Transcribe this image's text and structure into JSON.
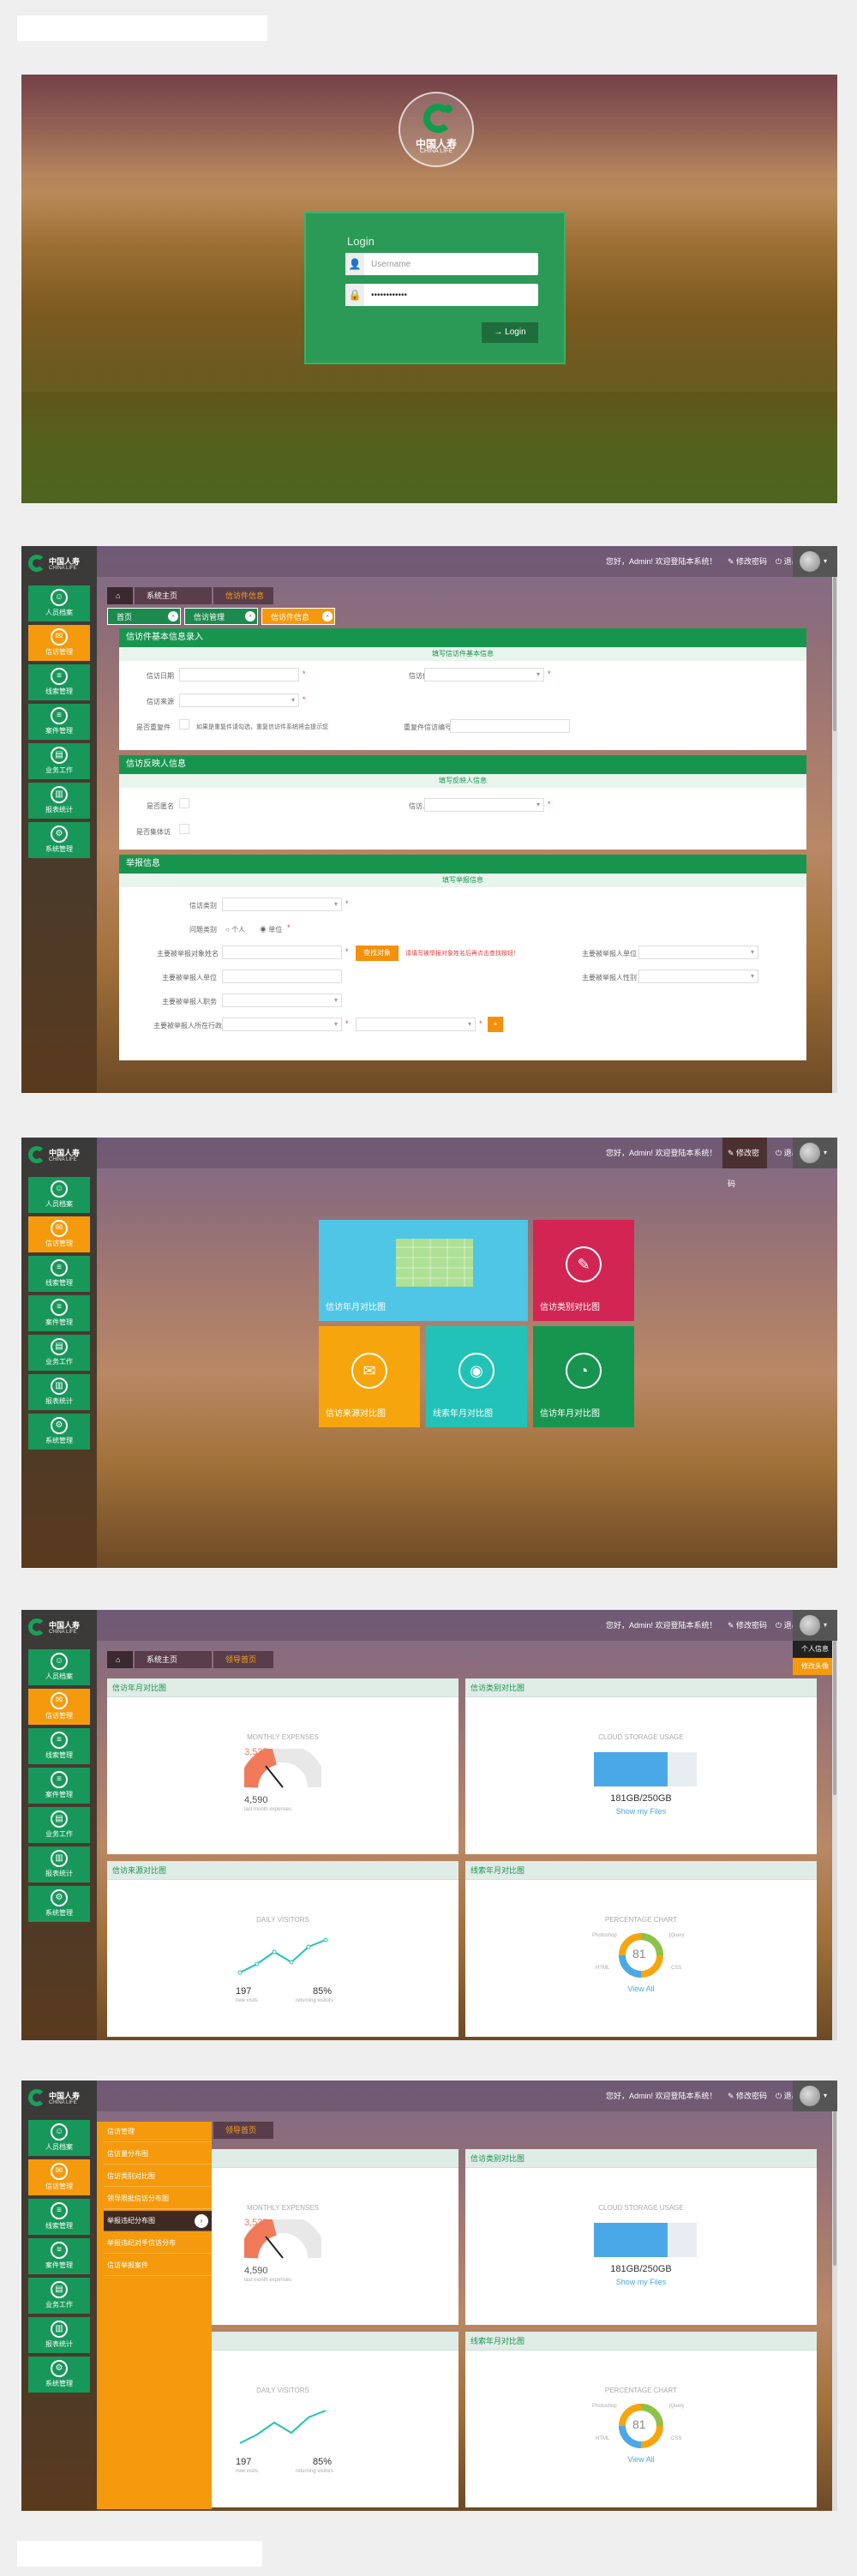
{
  "login": {
    "logo_cn": "中国人寿",
    "logo_en": "CHINA LIFE",
    "title": "Login",
    "username_placeholder": "Username",
    "password_value": "••••••••••••",
    "button": "Login",
    "user_icon": "user-icon",
    "lock_icon": "lock-icon"
  },
  "brand": {
    "cn": "中国人寿",
    "en": "CHINA LIFE"
  },
  "sidebar": {
    "items": [
      {
        "label": "人员档案",
        "icon": "person-icon"
      },
      {
        "label": "信访管理",
        "icon": "mail-icon"
      },
      {
        "label": "线索管理",
        "icon": "list-icon"
      },
      {
        "label": "案件管理",
        "icon": "list-icon"
      },
      {
        "label": "业务工作",
        "icon": "doc-icon"
      },
      {
        "label": "报表统计",
        "icon": "chart-icon"
      },
      {
        "label": "系统管理",
        "icon": "gear-icon"
      }
    ]
  },
  "topbar": {
    "greeting": "您好，Admin! 欢迎登陆本系统！",
    "change_pwd": "修改密码",
    "logout": "退出"
  },
  "screen2": {
    "crumbs": [
      "系统主页",
      "信访件信息"
    ],
    "tabs": [
      "首页",
      "信访管理",
      "信访件信息"
    ],
    "panel1": {
      "title": "信访件基本信息录入",
      "sub": "填写信访件基本信息",
      "f1": "信访日期",
      "f2": "信访件号",
      "f3": "信访来源",
      "f4": "是否重复件",
      "chk": "如果是重复件请勾选，重复信访件系统将会提示您",
      "f5": "重复件信访编号"
    },
    "panel2": {
      "title": "信访反映人信息",
      "sub": "填写反映人信息",
      "f1": "是否匿名",
      "f2": "信访人数",
      "f3": "是否集体访"
    },
    "panel3": {
      "title": "举报信息",
      "sub": "填写举报信息",
      "f1": "信访类别",
      "f2": "问题类别",
      "r1": "个人",
      "r2": "单位",
      "f3": "主要被举报对象姓名",
      "btn": "查找对象",
      "warn": "请填写被举报对象姓名后再点击查找按钮！",
      "f4": "主要被举报人单位",
      "f5": "主要被举报人职务",
      "f6": "主要被举报人职级",
      "f7": "主要被举报人性别",
      "f8": "主要被举报人所在行政区"
    }
  },
  "screen3": {
    "tiles": [
      {
        "label": "信访年月对比图",
        "color": "#4fc6e6",
        "icon": "chart-icon"
      },
      {
        "label": "信访类别对比图",
        "color": "#d32553",
        "icon": "pencil-icon"
      },
      {
        "label": "信访来源对比图",
        "color": "#f7a50d",
        "icon": "mail-icon"
      },
      {
        "label": "线索年月对比图",
        "color": "#23c2b8",
        "icon": "eye-icon"
      },
      {
        "label": "信访年月对比图",
        "color": "#17954f",
        "icon": "pie-icon"
      }
    ]
  },
  "screen4": {
    "crumbs": [
      "系统主页",
      "领导首页"
    ],
    "user_menu": [
      "个人信息",
      "修改头像"
    ],
    "cards": [
      {
        "title": "信访年月对比图",
        "widget": "MONTHLY EXPENSES",
        "v1": "3,535",
        "v2": "4,590",
        "v3": "last month expenses"
      },
      {
        "title": "信访类别对比图",
        "widget": "CLOUD STORAGE USAGE",
        "v1": "181GB/250GB",
        "v2": "Show my Files",
        "pct": 0.72
      },
      {
        "title": "信访来源对比图",
        "widget": "DAILY VISITORS",
        "v1": "197",
        "v2": "85%",
        "v3": "new visits",
        "v4": "returning visitors"
      },
      {
        "title": "线索年月对比图",
        "widget": "PERCENTAGE CHART",
        "v1": "81",
        "v2": "View All",
        "l1": "Photoshop",
        "l2": "jQuery",
        "l3": "HTML",
        "l4": "CSS"
      }
    ]
  },
  "screen5": {
    "menu": [
      "信访管理",
      "信访量分布图",
      "信访类别对比图",
      "领导限批信访分布图",
      "举报违纪分布图",
      "举报违纪对手信访分布",
      "信访举报案件"
    ],
    "crumb": "领导首页"
  },
  "colors": {
    "green": "#17954f",
    "orange": "#f59a0c"
  }
}
